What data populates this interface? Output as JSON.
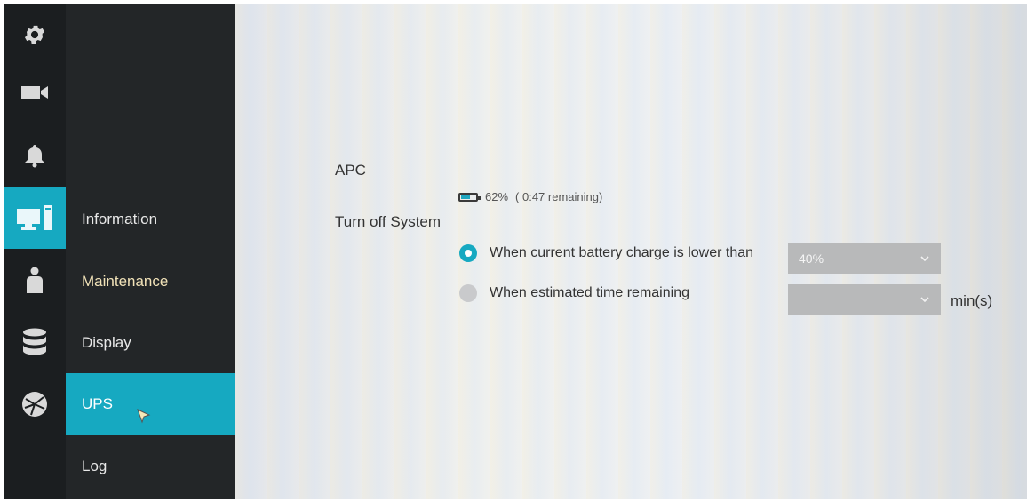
{
  "rail": {
    "icons": [
      "gear-icon",
      "camera-icon",
      "bell-icon",
      "computer-icon",
      "user-icon",
      "database-icon",
      "network-icon"
    ],
    "active_index": 3,
    "accent": "#16a9c1"
  },
  "submenu": {
    "items": [
      {
        "label": "Information"
      },
      {
        "label": "Maintenance"
      },
      {
        "label": "Display"
      },
      {
        "label": "UPS"
      },
      {
        "label": "Log"
      }
    ],
    "active_index": 3
  },
  "ups": {
    "vendor": "APC",
    "battery_percent": "62%",
    "battery_remaining": "( 0:47 remaining)",
    "battery_level": 0.62,
    "turn_off_label": "Turn off System",
    "options": [
      {
        "label": "When current battery charge is lower than",
        "selected": true,
        "value": "40%"
      },
      {
        "label": "When estimated time remaining",
        "selected": false,
        "value": "",
        "unit": "min(s)"
      }
    ]
  }
}
